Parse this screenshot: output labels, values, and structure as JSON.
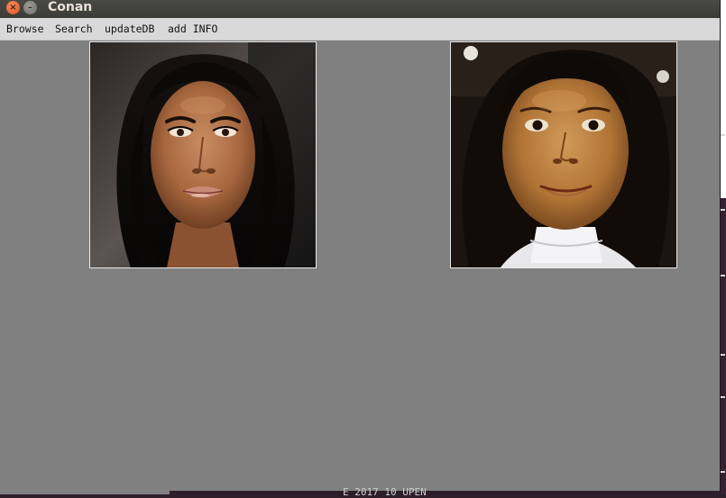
{
  "window": {
    "title": "Conan"
  },
  "window_controls": {
    "close_glyph": "×",
    "minimize_glyph": "–"
  },
  "menu": {
    "items": [
      {
        "label": "Browse"
      },
      {
        "label": "Search"
      },
      {
        "label": "updateDB"
      },
      {
        "label": "add INFO"
      }
    ]
  },
  "images": {
    "left": {
      "alt": "face photo (adult woman)"
    },
    "right": {
      "alt": "face photo (young girl)"
    }
  },
  "background": {
    "terminal_fragment": "E 2017  10 UPEN"
  },
  "colors": {
    "window_bg": "#808080",
    "menubar_bg": "#d9d9d9",
    "titlebar_bg": "#3b3b37",
    "close_button": "#e0531f"
  }
}
